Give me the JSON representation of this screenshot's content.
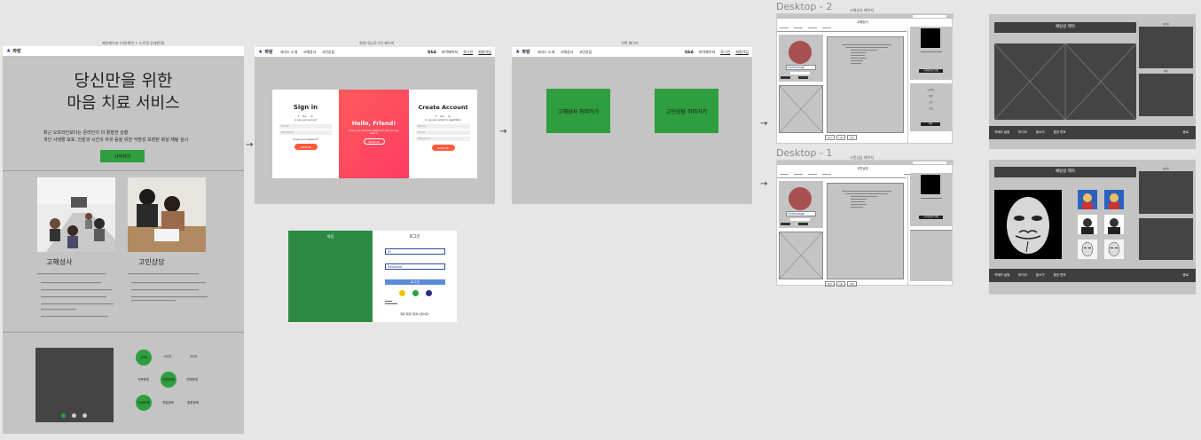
{
  "frames": {
    "main_label": "메인페이지 (기본화면 + 누르면 상태변경)",
    "login_label": "회원가입/로그인 페이지",
    "select_label": "선택 페이지",
    "desktop2_title": "Desktop - 2",
    "desktop1_title": "Desktop - 1",
    "d2_sub": "고해성사 페이지",
    "d1_sub": "고민상담 페이지"
  },
  "nav": {
    "logo": "파랑",
    "links": [
      "서비스 소개",
      "고해성사",
      "고민상담"
    ],
    "qa": "Q&A",
    "mypage": "마이페이지",
    "login": "로그인",
    "signup": "회원가입"
  },
  "hero": {
    "title_line1": "당신만을 위한",
    "title_line2": "마음 치료 서비스",
    "desc_line1": "최근 오프라인보다는 온라인이 더 활발한 상황",
    "desc_line2": "개인 사생활 보호, 인원과 시간의 자유 등을 위한 익명성 보장된 화상 채팅 실시",
    "start_button": "시작하기"
  },
  "services": {
    "left_title": "고해성사",
    "right_title": "고민상담"
  },
  "categories": [
    "10대",
    "20대",
    "30대",
    "가족문제",
    "연인문제",
    "연애문제",
    "진로문제",
    "취업문제",
    "결혼문제"
  ],
  "auth": {
    "sign_in_title": "Sign in",
    "hello_title": "Hello, Friend!",
    "hello_desc": "Enter your personal details and start journey with us",
    "hello_button": "SIGN UP",
    "create_title": "Create Account",
    "email_ph": "Email",
    "password_ph": "Password",
    "name_ph": "Name",
    "forgot": "Forgot your password?",
    "signin_button": "SIGN IN",
    "signup_button": "SIGN UP",
    "or_text": "or use your account",
    "or_email": "or use your email for registration"
  },
  "select": {
    "confession_button": "고해성사 하러가기",
    "counsel_button": "고민상담 하러가기"
  },
  "mobile_login": {
    "brand": "파랑",
    "title": "로그인",
    "id_ph": "ID",
    "pw_ph": "Password",
    "login_button": "로그인",
    "signup_text": "계정 회원가입하시겠어요?",
    "dot_colors": [
      "#f2c400",
      "#2e9e3e",
      "#2a2a8a"
    ]
  },
  "desktop_panel": {
    "image_label": "Homepage",
    "d2_heading": "고해성사",
    "d1_heading": "고민상담",
    "join_button": "고해성사방 입장",
    "join_button2": "고민상담방 입장",
    "menu_items": [
      "내 정보",
      "채팅",
      "친구",
      "음성",
      "영상"
    ],
    "footer_items": [
      "이전",
      "다음",
      "완료"
    ]
  },
  "chat": {
    "room_title_top": "채팅방 제목",
    "room_title_bottom": "채팅방 제목",
    "side_top_label": "참여자",
    "side_mid_label": "채팅",
    "footer_items": [
      "카메라 설정",
      "마이크",
      "음소거",
      "음성 변조"
    ],
    "exit": "종료"
  },
  "colors": {
    "green": "#2e9e3e",
    "pink": "#ff4b5c",
    "orange": "#ff5a3c",
    "navy": "#2a2a8a",
    "dark": "#3f3f3f"
  }
}
